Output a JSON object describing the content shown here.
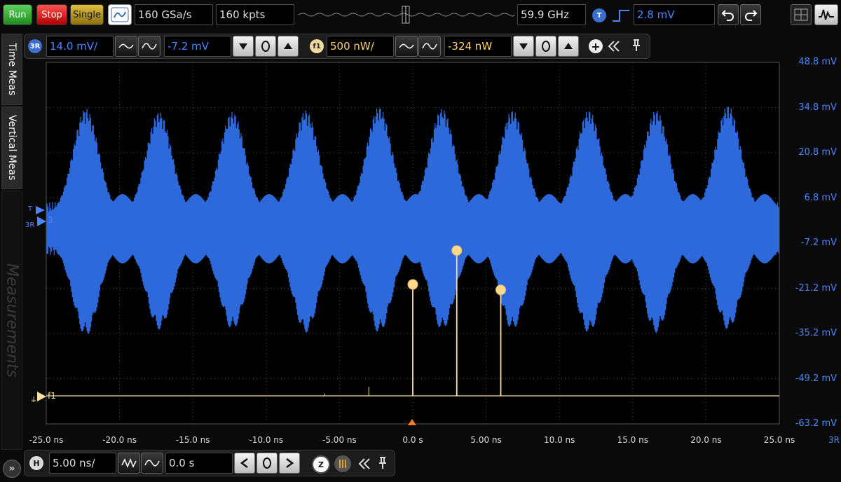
{
  "toolbar": {
    "run_label": "Run",
    "stop_label": "Stop",
    "single_label": "Single",
    "sample_rate": "160 GSa/s",
    "memory_depth": "160 kpts",
    "bandwidth": "59.9 GHz",
    "trigger_badge": "T",
    "trigger_level": "2.8 mV"
  },
  "channel_bar": {
    "ch_badge": "3R",
    "ch_scale": "14.0 mV/",
    "ch_offset": "-7.2 mV",
    "fn_badge": "f1",
    "fn_scale": "500 nW/",
    "fn_offset": "-324 nW"
  },
  "side_tabs": {
    "time_meas": "Time Meas",
    "vertical_meas": "Vertical Meas",
    "measurements": "Measurements"
  },
  "markers": {
    "trigger": "T",
    "channel": "3R",
    "channel_num": "3",
    "function": "f1",
    "x_axis_channel": "3R"
  },
  "y_axis_labels": [
    "48.8 mV",
    "34.8 mV",
    "20.8 mV",
    "6.8 mV",
    "-7.2 mV",
    "-21.2 mV",
    "-35.2 mV",
    "-49.2 mV",
    "-63.2 mV"
  ],
  "x_axis_labels": [
    "-25.0 ns",
    "-20.0 ns",
    "-15.0 ns",
    "-10.0 ns",
    "-5.00 ns",
    "0.0 s",
    "5.00 ns",
    "10.0 ns",
    "15.0 ns",
    "20.0 ns",
    "25.0 ns"
  ],
  "horizontal_bar": {
    "badge": "H",
    "scale": "5.00 ns/",
    "position": "0.0 s",
    "zoom_badge": "Z"
  },
  "colors": {
    "channel3": "#2f6fe6",
    "function1": "#ffe0a0",
    "grid": "#4a4a4a",
    "axis_text_blue": "#4a86ff"
  },
  "chart_data": {
    "type": "line",
    "xlabel": "",
    "ylabel": "",
    "x_unit": "ns",
    "xlim": [
      -25,
      25
    ],
    "ylim": [
      -63.2,
      48.8
    ],
    "y_unit": "mV",
    "series": [
      {
        "name": "3R",
        "color": "#2f6fe6",
        "burst_centers_ns": [
          -22.3,
          -17.3,
          -12.3,
          -7.3,
          -2.3,
          2.0,
          6.8,
          12.0,
          16.6,
          21.5
        ],
        "burst_peak_mV": [
          34.5,
          33.5,
          33.5,
          34.0,
          35.0,
          34.5,
          34.0,
          34.0,
          34.0,
          35.5
        ],
        "burst_trough_mV": [
          -36,
          -34,
          -34,
          -35,
          -35,
          -34,
          -34,
          -35,
          -35,
          -34
        ],
        "baseline_band_mV": [
          -7.5,
          2.0
        ]
      },
      {
        "name": "f1",
        "color": "#ffe0a0",
        "baseline_nW": -324,
        "spikes_ns": [
          0.0,
          3.0,
          6.0
        ],
        "spike_height_mV_on_grid": [
          -20.0,
          -9.5,
          -21.7
        ]
      }
    ]
  }
}
